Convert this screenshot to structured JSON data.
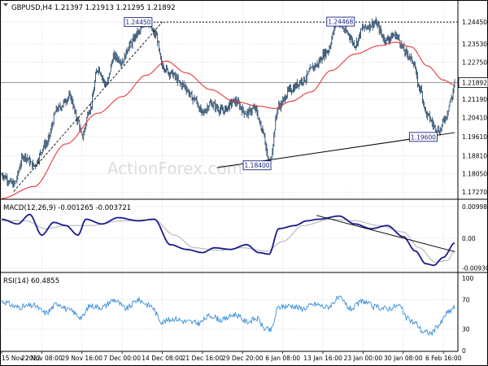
{
  "header": {
    "symbol_line": "GBPUSD,H4  1.21397 1.21913 1.21295 1.21892",
    "macd_label": "MACD(12,26,9) -0.001265 -0.003721",
    "rsi_label": "RSI(14) 60.4855"
  },
  "watermark": "ActionForex.com",
  "colors": {
    "price": "#2f4f6f",
    "ma": "#e8373a",
    "macd": "#1a1a8c",
    "signal": "#b0b0b0",
    "rsi": "#3a8fd9",
    "annotation_border": "#1a237e",
    "annotation_text": "#1a237e",
    "current_price_box": "#ffffff"
  },
  "chart_data": [
    {
      "type": "line",
      "panel": "price",
      "ylim": [
        1.17,
        1.249
      ],
      "y_ticks": [
        "1.24450",
        "1.23530",
        "1.22750",
        "1.21892",
        "1.21190",
        "1.20410",
        "1.19610",
        "1.18810",
        "1.18050",
        "1.17270"
      ],
      "y_tick_values": [
        1.2445,
        1.2353,
        1.2275,
        1.21892,
        1.2119,
        1.2041,
        1.1961,
        1.1881,
        1.1805,
        1.1727
      ],
      "current_price": "1.21892",
      "x_tick_labels": [
        "15 Nov 2022",
        "22 Nov 08:00",
        "29 Nov 16:00",
        "7 Dec 00:00",
        "14 Dec 08:00",
        "21 Dec 16:00",
        "29 Dec 20:00",
        "6 Jan 08:00",
        "13 Jan 16:00",
        "23 Jan 00:00",
        "30 Jan 08:00",
        "6 Feb 16:00"
      ],
      "x_tick_index": [
        0,
        50,
        100,
        150,
        200,
        250,
        300,
        350,
        400,
        450,
        500,
        550
      ],
      "n_bars": 565,
      "price_anchors": [
        [
          0,
          1.18
        ],
        [
          15,
          1.176
        ],
        [
          28,
          1.188
        ],
        [
          40,
          1.184
        ],
        [
          55,
          1.193
        ],
        [
          70,
          1.208
        ],
        [
          85,
          1.213
        ],
        [
          95,
          1.203
        ],
        [
          100,
          1.196
        ],
        [
          110,
          1.208
        ],
        [
          120,
          1.225
        ],
        [
          130,
          1.218
        ],
        [
          140,
          1.23
        ],
        [
          150,
          1.228
        ],
        [
          160,
          1.235
        ],
        [
          170,
          1.24
        ],
        [
          180,
          1.2445
        ],
        [
          192,
          1.239
        ],
        [
          200,
          1.226
        ],
        [
          210,
          1.223
        ],
        [
          225,
          1.218
        ],
        [
          240,
          1.212
        ],
        [
          250,
          1.206
        ],
        [
          260,
          1.21
        ],
        [
          275,
          1.207
        ],
        [
          290,
          1.211
        ],
        [
          305,
          1.206
        ],
        [
          315,
          1.208
        ],
        [
          325,
          1.199
        ],
        [
          333,
          1.1845
        ],
        [
          345,
          1.209
        ],
        [
          360,
          1.216
        ],
        [
          375,
          1.22
        ],
        [
          390,
          1.226
        ],
        [
          405,
          1.232
        ],
        [
          418,
          1.2447
        ],
        [
          430,
          1.24
        ],
        [
          440,
          1.235
        ],
        [
          450,
          1.242
        ],
        [
          465,
          1.244
        ],
        [
          478,
          1.237
        ],
        [
          490,
          1.239
        ],
        [
          505,
          1.231
        ],
        [
          512,
          1.228
        ],
        [
          520,
          1.217
        ],
        [
          530,
          1.205
        ],
        [
          540,
          1.2
        ],
        [
          545,
          1.1985
        ],
        [
          552,
          1.204
        ],
        [
          560,
          1.212
        ],
        [
          564,
          1.2189
        ]
      ],
      "ma_anchors": [
        [
          0,
          1.17
        ],
        [
          40,
          1.175
        ],
        [
          80,
          1.193
        ],
        [
          120,
          1.206
        ],
        [
          150,
          1.213
        ],
        [
          180,
          1.222
        ],
        [
          205,
          1.228
        ],
        [
          230,
          1.223
        ],
        [
          260,
          1.216
        ],
        [
          290,
          1.211
        ],
        [
          320,
          1.209
        ],
        [
          340,
          1.208
        ],
        [
          360,
          1.211
        ],
        [
          385,
          1.215
        ],
        [
          410,
          1.224
        ],
        [
          440,
          1.231
        ],
        [
          470,
          1.2345
        ],
        [
          490,
          1.236
        ],
        [
          510,
          1.234
        ],
        [
          530,
          1.226
        ],
        [
          550,
          1.22
        ],
        [
          564,
          1.218
        ]
      ],
      "annotations": [
        {
          "label": "1.24450",
          "index": 170,
          "price": 1.2445
        },
        {
          "label": "1.24468",
          "index": 422,
          "price": 1.24468
        },
        {
          "label": "1.18400",
          "index": 318,
          "price": 1.184
        },
        {
          "label": "1.19600",
          "index": 525,
          "price": 1.196
        }
      ],
      "resistance_level": 1.2445,
      "support_line": {
        "start": [
          268,
          1.183
        ],
        "end": [
          565,
          1.1978
        ]
      },
      "dashed_trend": {
        "start": [
          15,
          1.173
        ],
        "end": [
          200,
          1.2445
        ]
      }
    },
    {
      "type": "line",
      "panel": "macd",
      "ylim": [
        -0.0105,
        0.011
      ],
      "y_ticks": [
        "0.009986",
        "0.00",
        "-0.009305"
      ],
      "y_tick_values": [
        0.009986,
        0.0,
        -0.009305
      ],
      "macd_anchors": [
        [
          0,
          0.006
        ],
        [
          20,
          0.0045
        ],
        [
          35,
          0.0075
        ],
        [
          50,
          0.001
        ],
        [
          65,
          0.005
        ],
        [
          80,
          0.004
        ],
        [
          95,
          0.001
        ],
        [
          105,
          0.006
        ],
        [
          125,
          0.0045
        ],
        [
          145,
          0.0065
        ],
        [
          170,
          0.0055
        ],
        [
          190,
          0.006
        ],
        [
          210,
          -0.002
        ],
        [
          230,
          -0.0035
        ],
        [
          250,
          -0.0045
        ],
        [
          265,
          -0.003
        ],
        [
          285,
          -0.0035
        ],
        [
          305,
          -0.002
        ],
        [
          320,
          -0.0045
        ],
        [
          333,
          -0.005
        ],
        [
          345,
          0.003
        ],
        [
          365,
          0.004
        ],
        [
          380,
          0.0055
        ],
        [
          395,
          0.006
        ],
        [
          420,
          0.007
        ],
        [
          440,
          0.0045
        ],
        [
          460,
          0.003
        ],
        [
          480,
          0.004
        ],
        [
          500,
          0.0005
        ],
        [
          515,
          -0.004
        ],
        [
          528,
          -0.008
        ],
        [
          538,
          -0.0085
        ],
        [
          550,
          -0.006
        ],
        [
          564,
          -0.0015
        ]
      ],
      "signal_anchors": [
        [
          0,
          0.0055
        ],
        [
          30,
          0.0055
        ],
        [
          55,
          0.003
        ],
        [
          80,
          0.004
        ],
        [
          110,
          0.004
        ],
        [
          150,
          0.0055
        ],
        [
          190,
          0.0058
        ],
        [
          215,
          0.001
        ],
        [
          240,
          -0.003
        ],
        [
          270,
          -0.0038
        ],
        [
          300,
          -0.003
        ],
        [
          330,
          -0.004
        ],
        [
          350,
          -0.001
        ],
        [
          375,
          0.004
        ],
        [
          410,
          0.006
        ],
        [
          440,
          0.0055
        ],
        [
          470,
          0.004
        ],
        [
          500,
          0.002
        ],
        [
          520,
          -0.003
        ],
        [
          540,
          -0.0075
        ],
        [
          555,
          -0.007
        ],
        [
          564,
          -0.004
        ]
      ],
      "trendline": {
        "start": [
          392,
          0.0072
        ],
        "end": [
          565,
          -0.0042
        ]
      }
    },
    {
      "type": "line",
      "panel": "rsi",
      "ylim": [
        0,
        100
      ],
      "y_ticks": [
        "100",
        "70",
        "30",
        "0"
      ],
      "y_tick_values": [
        100,
        70,
        30,
        0
      ],
      "rsi_anchors": [
        [
          0,
          68
        ],
        [
          20,
          60
        ],
        [
          40,
          62
        ],
        [
          55,
          52
        ],
        [
          70,
          65
        ],
        [
          85,
          55
        ],
        [
          100,
          46
        ],
        [
          110,
          62
        ],
        [
          125,
          60
        ],
        [
          140,
          70
        ],
        [
          155,
          58
        ],
        [
          170,
          70
        ],
        [
          185,
          62
        ],
        [
          200,
          40
        ],
        [
          215,
          44
        ],
        [
          230,
          40
        ],
        [
          245,
          38
        ],
        [
          260,
          48
        ],
        [
          275,
          42
        ],
        [
          290,
          50
        ],
        [
          305,
          40
        ],
        [
          318,
          44
        ],
        [
          328,
          30
        ],
        [
          335,
          28
        ],
        [
          345,
          60
        ],
        [
          360,
          62
        ],
        [
          375,
          58
        ],
        [
          390,
          64
        ],
        [
          405,
          60
        ],
        [
          420,
          72
        ],
        [
          435,
          58
        ],
        [
          450,
          68
        ],
        [
          465,
          60
        ],
        [
          480,
          58
        ],
        [
          495,
          62
        ],
        [
          505,
          44
        ],
        [
          515,
          38
        ],
        [
          525,
          26
        ],
        [
          535,
          24
        ],
        [
          545,
          36
        ],
        [
          555,
          52
        ],
        [
          564,
          60
        ]
      ]
    }
  ]
}
